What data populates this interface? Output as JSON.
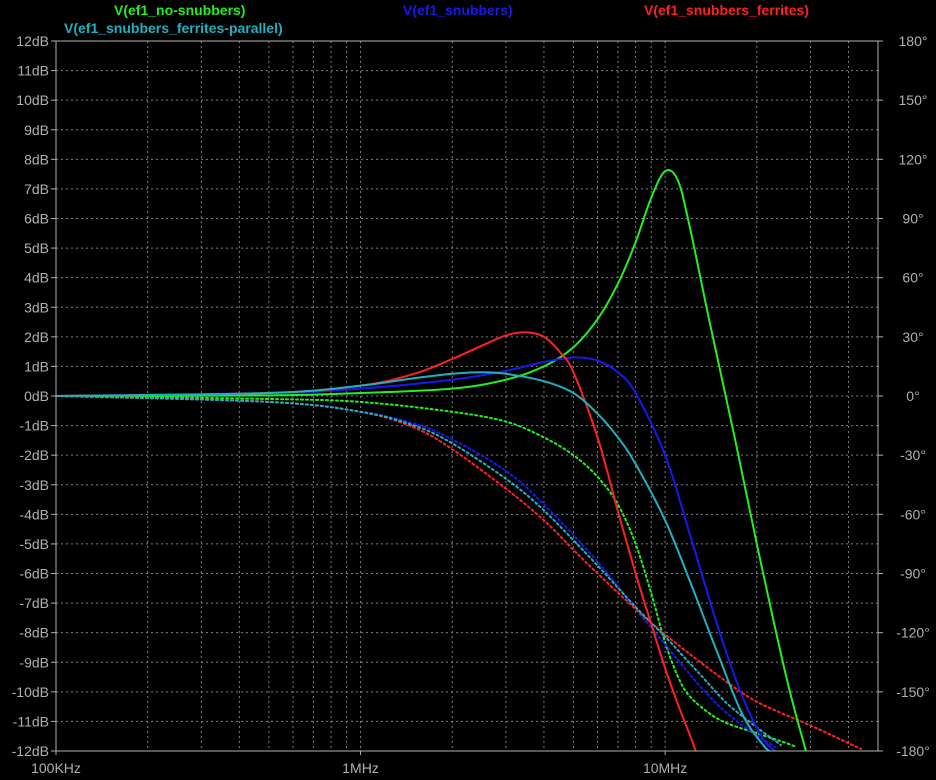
{
  "chart_data": {
    "type": "line",
    "title": "",
    "x_scale": "log",
    "x_unit": "Hz",
    "xlim": [
      100000,
      50000000
    ],
    "x_ticks": [
      {
        "value": 100000,
        "label": "100KHz"
      },
      {
        "value": 1000000,
        "label": "1MHz"
      },
      {
        "value": 10000000,
        "label": "10MHz"
      }
    ],
    "ylim": [
      -12,
      12
    ],
    "y_ticks": [
      12,
      11,
      10,
      9,
      8,
      7,
      6,
      5,
      4,
      3,
      2,
      1,
      0,
      -1,
      -2,
      -3,
      -4,
      -5,
      -6,
      -7,
      -8,
      -9,
      -10,
      -11,
      -12
    ],
    "y_tick_labels": [
      "12dB",
      "11dB",
      "10dB",
      "9dB",
      "8dB",
      "7dB",
      "6dB",
      "5dB",
      "4dB",
      "3dB",
      "2dB",
      "1dB",
      "0dB",
      "-1dB",
      "-2dB",
      "-3dB",
      "-4dB",
      "-5dB",
      "-6dB",
      "-7dB",
      "-8dB",
      "-9dB",
      "-10dB",
      "-11dB",
      "-12dB"
    ],
    "y2lim": [
      -180,
      180
    ],
    "y2_ticks": [
      180,
      150,
      120,
      90,
      60,
      30,
      0,
      -30,
      -60,
      -90,
      -120,
      -150,
      -180
    ],
    "y2_tick_labels": [
      "180°",
      "150°",
      "120°",
      "90°",
      "60°",
      "30°",
      "0°",
      "-30°",
      "-60°",
      "-90°",
      "-120°",
      "-150°",
      "-180°"
    ],
    "grid": true,
    "grid_color": "#808080",
    "axis_color": "#b0b0b0",
    "background": "#000000",
    "series": [
      {
        "name": "V(ef1_no-snubbers)",
        "color": "#22ee22",
        "magnitude": {
          "x": [
            100000,
            500000,
            1000000,
            2000000,
            3000000,
            4000000,
            5000000,
            6000000,
            7000000,
            8000000,
            9000000,
            10000000,
            11000000,
            12000000,
            14000000,
            17000000,
            20000000,
            25000000,
            29000000
          ],
          "y": [
            0,
            0.02,
            0.1,
            0.25,
            0.55,
            1.0,
            1.65,
            2.6,
            3.8,
            5.2,
            6.7,
            7.6,
            7.3,
            5.8,
            2.5,
            -1.5,
            -5.0,
            -9.5,
            -12.0
          ]
        },
        "phase": {
          "x": [
            100000,
            500000,
            1000000,
            2000000,
            3000000,
            4000000,
            5000000,
            6000000,
            7000000,
            8000000,
            9000000,
            10000000,
            11000000,
            12000000,
            14000000,
            16000000,
            20000000,
            25000000,
            27000000
          ],
          "y": [
            0,
            -1.5,
            -3,
            -8,
            -13,
            -21,
            -30,
            -41,
            -55,
            -75,
            -100,
            -125,
            -142,
            -152,
            -161,
            -166,
            -171,
            -176,
            -178
          ]
        }
      },
      {
        "name": "V(ef1_snubbers)",
        "color": "#1818ee",
        "magnitude": {
          "x": [
            100000,
            500000,
            1000000,
            2000000,
            3000000,
            4000000,
            5000000,
            6000000,
            7000000,
            8000000,
            10000000,
            12000000,
            15000000,
            18000000,
            21000000,
            23000000
          ],
          "y": [
            0,
            0.1,
            0.25,
            0.55,
            0.85,
            1.15,
            1.3,
            1.2,
            0.8,
            0.1,
            -2.0,
            -4.6,
            -7.9,
            -10.2,
            -11.6,
            -12.0
          ]
        },
        "phase": {
          "x": [
            100000,
            500000,
            1000000,
            1500000,
            2000000,
            3000000,
            4000000,
            6000000,
            8000000,
            10000000,
            13000000,
            16000000,
            20000000,
            23000000
          ],
          "y": [
            0,
            -3,
            -8,
            -14,
            -22,
            -38,
            -55,
            -84,
            -108,
            -126,
            -147,
            -161,
            -172,
            -178
          ]
        }
      },
      {
        "name": "V(ef1_snubbers_ferrites)",
        "color": "#ff2020",
        "magnitude": {
          "x": [
            100000,
            500000,
            1000000,
            1500000,
            2000000,
            2500000,
            3000000,
            3500000,
            4000000,
            4500000,
            5000000,
            6000000,
            7000000,
            8000000,
            9000000,
            10000000,
            11000000,
            12000000,
            12600000
          ],
          "y": [
            0,
            0.1,
            0.35,
            0.75,
            1.25,
            1.7,
            2.05,
            2.15,
            2.0,
            1.5,
            0.8,
            -1.4,
            -3.9,
            -6.0,
            -7.7,
            -9.2,
            -10.4,
            -11.4,
            -12.0
          ]
        },
        "phase": {
          "x": [
            100000,
            500000,
            1000000,
            1500000,
            2000000,
            3000000,
            4000000,
            5000000,
            6000000,
            8000000,
            10000000,
            15000000,
            20000000,
            30000000,
            40000000,
            44000000
          ],
          "y": [
            0,
            -3,
            -8,
            -16,
            -27,
            -47,
            -63,
            -78,
            -90,
            -108,
            -121,
            -142,
            -155,
            -167,
            -176,
            -179
          ]
        }
      },
      {
        "name": "V(ef1_snubbers_ferrites-parallel)",
        "color": "#20b0c0",
        "magnitude": {
          "x": [
            100000,
            500000,
            1000000,
            1500000,
            2000000,
            2500000,
            3000000,
            4000000,
            5000000,
            6000000,
            7000000,
            8000000,
            10000000,
            12000000,
            15000000,
            18000000,
            21000000,
            22000000
          ],
          "y": [
            0,
            0.1,
            0.35,
            0.6,
            0.75,
            0.8,
            0.75,
            0.5,
            0.1,
            -0.6,
            -1.4,
            -2.3,
            -4.2,
            -6.2,
            -8.8,
            -10.8,
            -11.8,
            -12.0
          ]
        },
        "phase": {
          "x": [
            100000,
            500000,
            1000000,
            1500000,
            2000000,
            3000000,
            4000000,
            6000000,
            8000000,
            10000000,
            13000000,
            16000000,
            20000000,
            24000000
          ],
          "y": [
            0,
            -3,
            -8,
            -15,
            -24,
            -42,
            -58,
            -86,
            -107,
            -122,
            -141,
            -156,
            -168,
            -177
          ]
        }
      }
    ]
  }
}
